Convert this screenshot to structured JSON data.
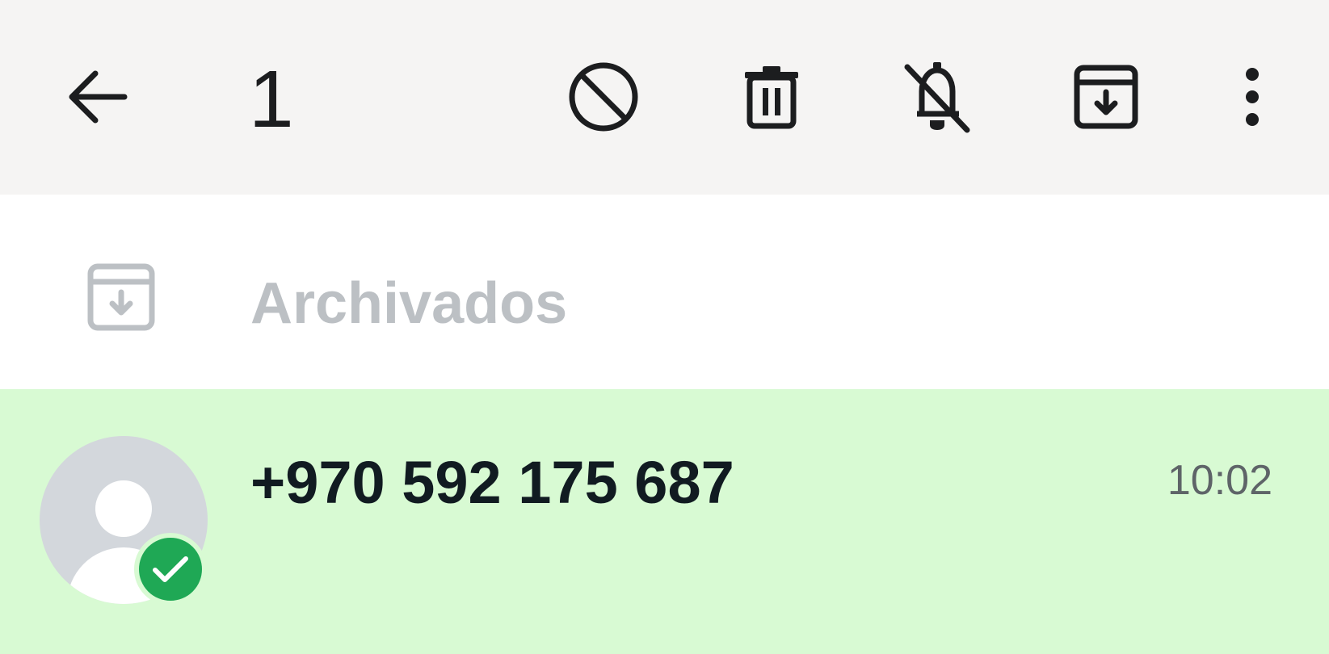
{
  "toolbar": {
    "selected_count": "1",
    "icons": [
      "back-arrow-icon",
      "block-icon",
      "delete-icon",
      "mute-icon",
      "archive-icon",
      "more-options-icon"
    ]
  },
  "archived": {
    "label": "Archivados",
    "icon": "archive-icon"
  },
  "chats": [
    {
      "name": "+970 592 175 687",
      "time": "10:02",
      "selected": true,
      "avatar": "default-avatar-icon"
    }
  ],
  "colors": {
    "toolbar_bg": "#f5f4f3",
    "selected_row_bg": "#d8fad3",
    "check_badge": "#1fa855",
    "muted_text": "#bcc0c4",
    "primary_text": "#111b21"
  }
}
